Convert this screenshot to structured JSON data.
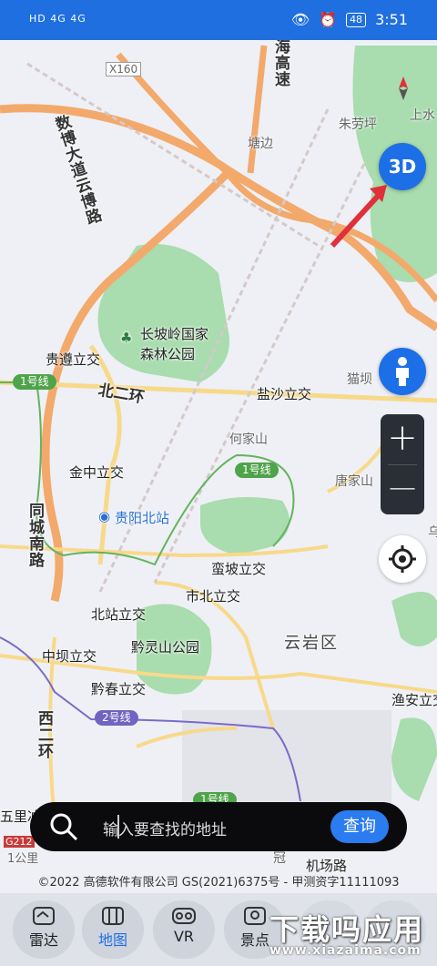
{
  "status_bar": {
    "left_indicators": "HD 4G 4G",
    "battery": "48",
    "time": "3:51"
  },
  "map": {
    "labels": {
      "x160": "X160",
      "shuguan": "数博大道云博路",
      "haigao": "海高速",
      "tangbian": "塘边",
      "zhulaoping": "朱劳坪",
      "shangshui": "上水",
      "changpoling": "长坡岭国家",
      "forest_park": "森林公园",
      "guizun": "贵遵立交",
      "beierhuan": "北二环",
      "yansha": "盐沙立交",
      "maoba": "猫坝",
      "hejiashan": "何家山",
      "jinzhong": "金中立交",
      "tangjiashan": "唐家山",
      "tongcheng": "同城南路",
      "guiyang_north": "贵阳北站",
      "manpo": "蛮坡立交",
      "shibei": "市北立交",
      "beizhan": "北站立交",
      "yunyan": "云岩区",
      "qianling": "黔灵山公园",
      "zhongba": "中坝立交",
      "qianchun": "黔春立交",
      "xierhuan": "西二环",
      "yuan": "渔安立交",
      "wulichong": "五里冲",
      "g212": "G212",
      "scale": "1公里",
      "jichang": "机场路",
      "airport_cut": "冠",
      "partial_cut": "乌"
    },
    "metro": {
      "line1_a": "1号线",
      "line1_b": "1号线",
      "line1_c": "1号线",
      "line2": "2号线"
    },
    "btn_3d": "3D",
    "zoom_in": "+",
    "zoom_out": "—"
  },
  "search": {
    "placeholder": "输入要查找的地址",
    "button": "查询"
  },
  "copyright": "©2022 高德软件有限公司 GS(2021)6375号 - 甲测资字11111093",
  "tabs": [
    {
      "label": "雷达"
    },
    {
      "label": "地图"
    },
    {
      "label": "VR"
    },
    {
      "label": "景点"
    }
  ],
  "watermark": {
    "title": "下载吗应用",
    "url": "www.xiazaima.com"
  },
  "colors": {
    "accent": "#1c6fe6",
    "status_bar": "#1f6fe0",
    "park": "#a9dcae",
    "arrow": "#e0303a"
  }
}
